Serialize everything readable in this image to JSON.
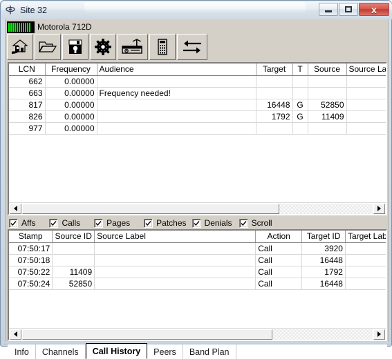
{
  "window": {
    "title": "Site 32",
    "icon": "trunking-site-icon",
    "buttons": {
      "minimize": "minimize-icon",
      "maximize": "maximize-icon",
      "close": "x"
    }
  },
  "status": {
    "signal_icon": "signal-strength-meter",
    "signal_bars": 11,
    "device_name": "Motorola 712D"
  },
  "toolbar": {
    "buttons": [
      {
        "name": "home-icon",
        "tip": "Home"
      },
      {
        "name": "open-folder-icon",
        "tip": "Open"
      },
      {
        "name": "save-disk-icon",
        "tip": "Save"
      },
      {
        "name": "gear-icon",
        "tip": "Settings"
      },
      {
        "name": "radio-receiver-icon",
        "tip": "Receiver"
      },
      {
        "name": "calculator-icon",
        "tip": "Calculator"
      },
      {
        "name": "transfer-arrows-icon",
        "tip": "Transfer"
      }
    ]
  },
  "channels_grid": {
    "columns": [
      "LCN",
      "Frequency",
      "Audience",
      "Target",
      "T",
      "Source",
      "Source Label"
    ],
    "rows": [
      {
        "lcn": "662",
        "frequency": "0.00000",
        "audience": "",
        "target": "",
        "t": "",
        "source": "",
        "source_label": "",
        "color": "black"
      },
      {
        "lcn": "663",
        "frequency": "0.00000",
        "audience": "Frequency needed!",
        "target": "",
        "t": "",
        "source": "",
        "source_label": "",
        "color": "red"
      },
      {
        "lcn": "817",
        "frequency": "0.00000",
        "audience": "",
        "target": "16448",
        "t": "G",
        "source": "52850",
        "source_label": "",
        "color": "black",
        "id_color": "green"
      },
      {
        "lcn": "826",
        "frequency": "0.00000",
        "audience": "",
        "target": "1792",
        "t": "G",
        "source": "11409",
        "source_label": "",
        "color": "black",
        "id_color": "green"
      },
      {
        "lcn": "977",
        "frequency": "0.00000",
        "audience": "",
        "target": "",
        "t": "",
        "source": "",
        "source_label": "",
        "color": "yellow"
      }
    ]
  },
  "filters": {
    "items": [
      {
        "label": "Affs",
        "checked": true
      },
      {
        "label": "Calls",
        "checked": true
      },
      {
        "label": "Pages",
        "checked": true
      },
      {
        "label": "Patches",
        "checked": true
      },
      {
        "label": "Denials",
        "checked": true
      },
      {
        "label": "Scroll",
        "checked": true
      }
    ]
  },
  "call_history_grid": {
    "columns": [
      "Stamp",
      "Source ID",
      "Source Label",
      "Action",
      "Target ID",
      "Target Label"
    ],
    "rows": [
      {
        "stamp": "07:50:17",
        "source_id": "",
        "source_label": "",
        "action": "Call",
        "target_id": "3920",
        "target_label": ""
      },
      {
        "stamp": "07:50:18",
        "source_id": "",
        "source_label": "",
        "action": "Call",
        "target_id": "16448",
        "target_label": ""
      },
      {
        "stamp": "07:50:22",
        "source_id": "11409",
        "source_label": "",
        "action": "Call",
        "target_id": "1792",
        "target_label": ""
      },
      {
        "stamp": "07:50:24",
        "source_id": "52850",
        "source_label": "",
        "action": "Call",
        "target_id": "16448",
        "target_label": ""
      }
    ]
  },
  "tabs": {
    "items": [
      "Info",
      "Channels",
      "Call History",
      "Peers",
      "Band Plan"
    ],
    "active": "Call History"
  },
  "scrollbars": {
    "left_arrow": "scroll-left-arrow",
    "right_arrow": "scroll-right-arrow"
  },
  "colors": {
    "green": "#00d000",
    "red": "#ff0000",
    "yellow": "#e8e800",
    "face": "#d4d0c8",
    "close": "#bb3a30"
  }
}
